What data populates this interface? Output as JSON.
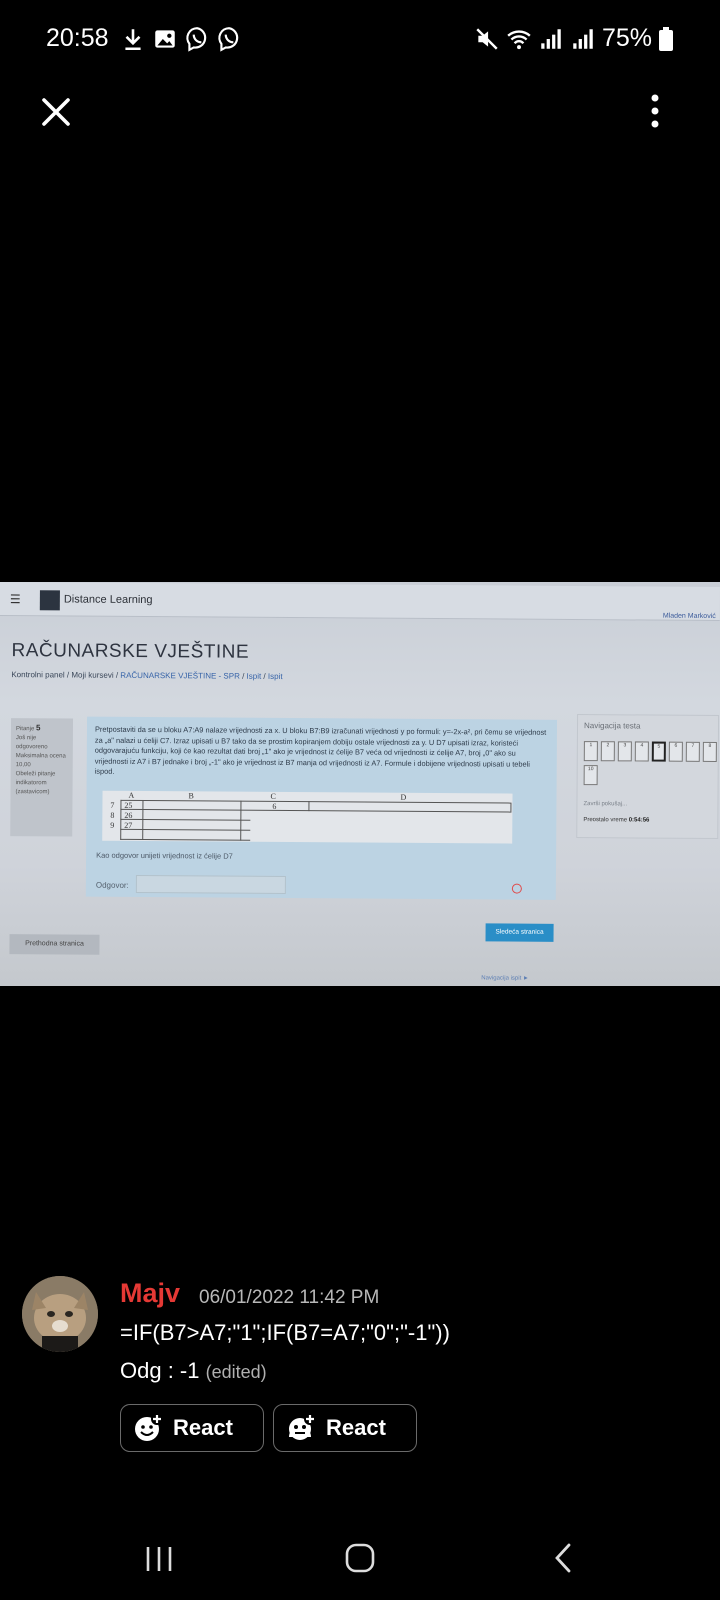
{
  "status_bar": {
    "time": "20:58",
    "battery": "75%",
    "left_icons": [
      "download-icon",
      "image-icon",
      "viber-icon",
      "viber-icon"
    ],
    "right_icons": [
      "mute-icon",
      "wifi-icon",
      "signal-icon",
      "signal-icon",
      "battery-icon"
    ]
  },
  "viewer": {
    "close_icon": "close-icon",
    "more_icon": "more-vert-icon"
  },
  "photo": {
    "app_name": "Distance Learning",
    "user": "Mladen Marković",
    "course_title": "RAČUNARSKE VJEŠTINE",
    "breadcrumb": [
      "Kontrolni panel",
      "Moji kursevi",
      "RAČUNARSKE VJEŠTINE - SPR",
      "Ispit",
      "Ispit"
    ],
    "question_info": {
      "label": "Pitanje",
      "number": "5",
      "status": "Još nije odgovoreno",
      "max_label": "Maksimalna ocena 10,00",
      "flag": "Obeleži pitanje indikatorom (zastavicom)"
    },
    "question_text": "Pretpostaviti da se u bloku A7:A9 nalaze vrijednosti za x. U bloku B7:B9 izračunati vrijednosti y po formuli: y=-2x-a², pri čemu se vrijednost za „a\" nalazi u ćeliji C7. Izraz upisati u B7 tako da se prostim kopiranjem dobiju ostale vrijednosti za y. U D7 upisati izraz, koristeći odgovarajuću funkciju, koji će kao rezultat dati broj „1\" ako je vrijednost iz ćelije B7 veća od vrijednosti iz ćelije A7, broj „0\" ako su vrijednosti iz A7 i B7 jednake i broj „-1\" ako je vrijednost iz B7 manja od vrijednosti iz A7. Formule i dobijene vrijednosti upisati u tebeli ispod.",
    "sheet": {
      "columns": [
        "A",
        "B",
        "C",
        "D"
      ],
      "rows": [
        {
          "row": "7",
          "a": "25",
          "c": "6"
        },
        {
          "row": "8",
          "a": "26",
          "c": ""
        },
        {
          "row": "9",
          "a": "27",
          "c": ""
        }
      ]
    },
    "answer_note": "Kao odgovor unijeti vrijednost iz ćelije D7",
    "answer_label": "Odgovor:",
    "nav_title": "Navigacija testa",
    "nav_cells": [
      "1",
      "2",
      "3",
      "4",
      "5",
      "6",
      "7",
      "8",
      "10"
    ],
    "nav_finish": "Završi pokušaj...",
    "nav_time_label": "Preostalo vreme",
    "nav_time": "0:54:56",
    "next_button": "Sledeća stranica",
    "prev_button": "Prethodna stranica",
    "footer_link": "Navigacija ispit ►"
  },
  "message": {
    "author": "Majv",
    "timestamp": "06/01/2022 11:42 PM",
    "line1": "=IF(B7>A7;\"1\";IF(B7=A7;\"0\";\"-1\"))",
    "line2": "Odg : -1",
    "edited": "(edited)",
    "react_buttons": [
      {
        "label": "React",
        "icon": "add-reaction-icon"
      },
      {
        "label": "React",
        "icon": "add-reaction-alt-icon"
      }
    ]
  },
  "colors": {
    "author": "#e53935",
    "background": "#000000",
    "next_button": "#2a8ec7"
  }
}
